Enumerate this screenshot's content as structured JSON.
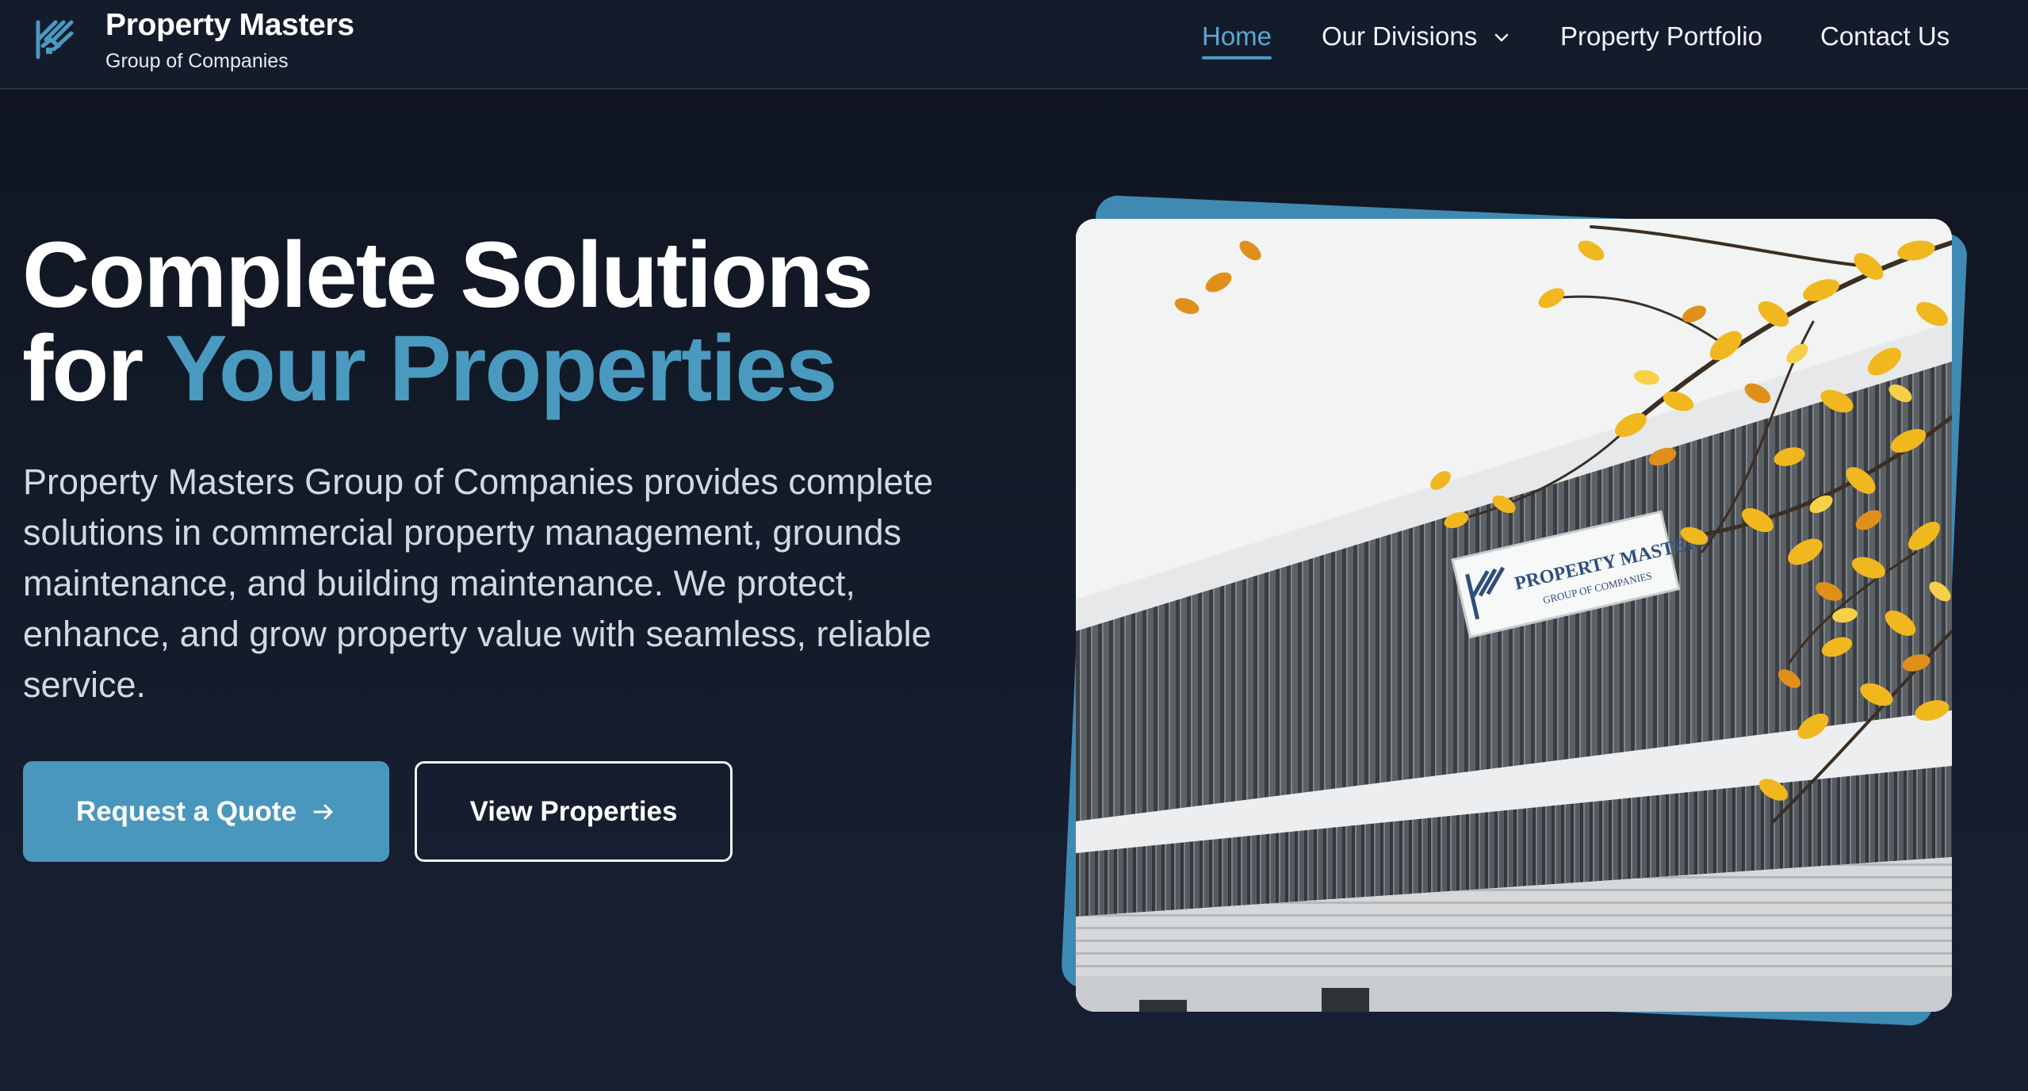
{
  "brand": {
    "name": "Property Masters",
    "subtitle": "Group of Companies",
    "logo_icon": "pm-house-logo-icon",
    "accent_color": "#4a97bd"
  },
  "nav": {
    "items": [
      {
        "label": "Home",
        "active": true
      },
      {
        "label": "Our Divisions",
        "has_dropdown": true
      },
      {
        "label": "Property Portfolio"
      },
      {
        "label": "Contact Us"
      }
    ]
  },
  "hero": {
    "title_line1": "Complete Solutions",
    "title_line2_prefix": "for ",
    "title_line2_accent": "Your Properties",
    "description": "Property Masters Group of Companies provides complete solutions in commercial property management, grounds maintenance, and building maintenance. We protect, enhance, and grow property value with seamless, reliable service.",
    "primary_button": "Request a Quote",
    "secondary_button": "View Properties"
  },
  "photo": {
    "sign_title": "PROPERTY MASTERS",
    "sign_sub": "GROUP OF COMPANIES"
  }
}
